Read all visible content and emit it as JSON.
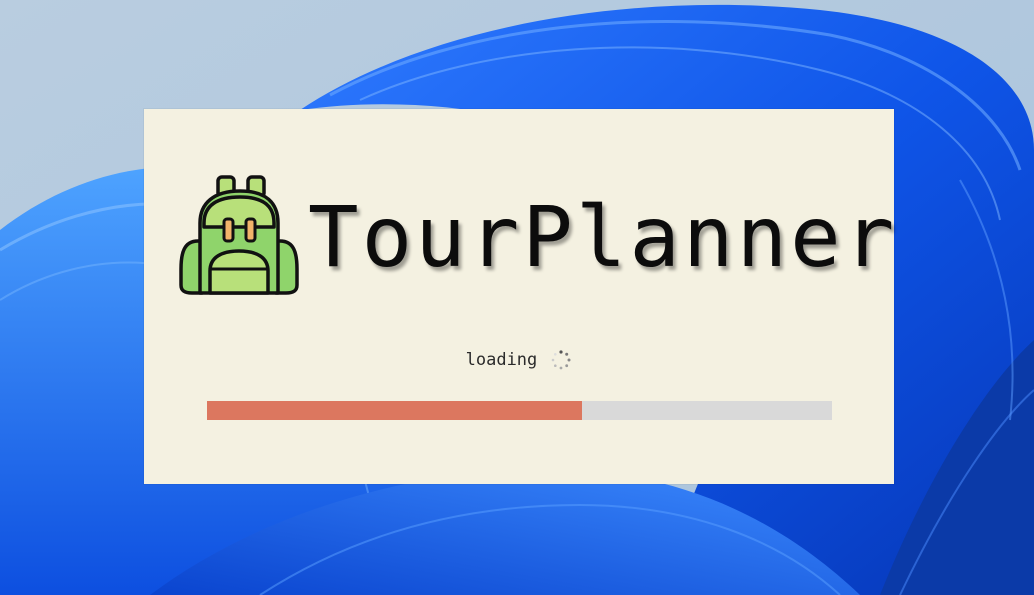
{
  "app": {
    "title": "TourPlanner",
    "icon": "backpack-icon"
  },
  "splash": {
    "loading_text": "loading",
    "spinner_icon": "spinner-icon",
    "progress": 0.6
  },
  "colors": {
    "splash_background": "#f4f1e1",
    "progress_fill": "#dc775f",
    "progress_track": "#d9d9d9",
    "backpack_green": "#8fd46b",
    "backpack_light_green": "#b8e07a",
    "backpack_strap": "#f2b46a",
    "wallpaper_blue": "#1a5cf0"
  }
}
